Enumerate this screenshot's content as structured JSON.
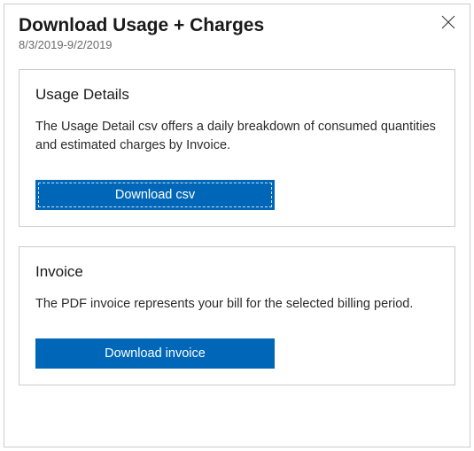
{
  "header": {
    "title": "Download Usage + Charges",
    "date_range": "8/3/2019-9/2/2019"
  },
  "usage": {
    "title": "Usage Details",
    "description": "The Usage Detail csv offers a daily breakdown of consumed quantities and estimated charges by Invoice.",
    "button_label": "Download csv"
  },
  "invoice": {
    "title": "Invoice",
    "description": "The PDF invoice represents your bill for the selected billing period.",
    "button_label": "Download invoice"
  },
  "colors": {
    "primary": "#0067b8"
  }
}
